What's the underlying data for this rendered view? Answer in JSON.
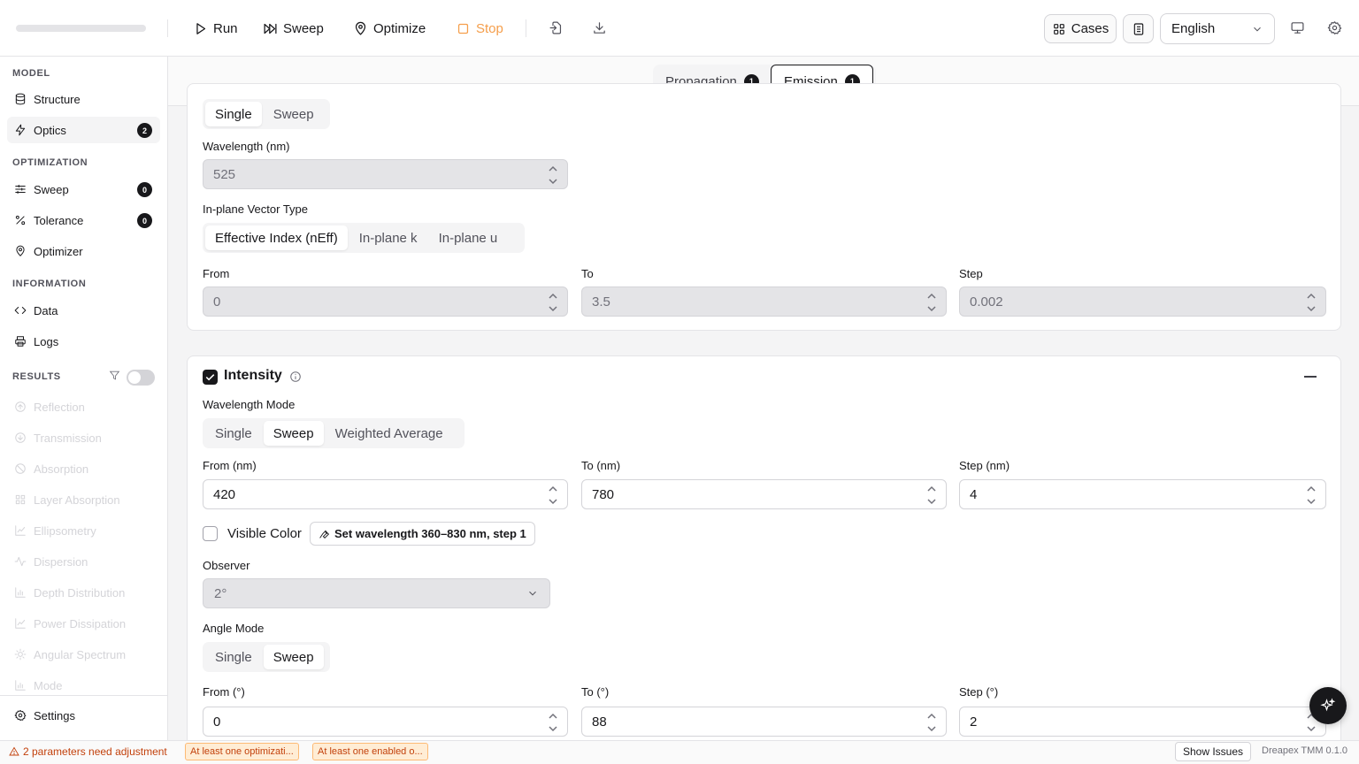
{
  "toolbar": {
    "run": "Run",
    "sweep": "Sweep",
    "optimize": "Optimize",
    "stop": "Stop",
    "cases": "Cases",
    "language": "English",
    "stop_color": "#f59e4b"
  },
  "sidebar": {
    "model_title": "MODEL",
    "structure": "Structure",
    "optics": "Optics",
    "optics_badge": "2",
    "optimization_title": "OPTIMIZATION",
    "sweep": "Sweep",
    "sweep_badge": "0",
    "tolerance": "Tolerance",
    "tolerance_badge": "0",
    "optimizer": "Optimizer",
    "information_title": "INFORMATION",
    "data": "Data",
    "logs": "Logs",
    "results_title": "RESULTS",
    "results": [
      "Reflection",
      "Transmission",
      "Absorption",
      "Layer Absorption",
      "Ellipsometry",
      "Dispersion",
      "Depth Distribution",
      "Power Dissipation",
      "Angular Spectrum",
      "Mode"
    ],
    "settings": "Settings"
  },
  "tabs": {
    "propagation": "Propagation",
    "propagation_badge": "1",
    "emission": "Emission",
    "emission_badge": "1"
  },
  "card1": {
    "mode_single": "Single",
    "mode_sweep": "Sweep",
    "wavelength_label": "Wavelength (nm)",
    "wavelength_value": "525",
    "vector_label": "In-plane Vector Type",
    "vector_options": [
      "Effective Index (nEff)",
      "In-plane k",
      "In-plane u"
    ],
    "from_label": "From",
    "from_value": "0",
    "to_label": "To",
    "to_value": "3.5",
    "step_label": "Step",
    "step_value": "0.002"
  },
  "card2": {
    "title": "Intensity",
    "wl_mode_label": "Wavelength Mode",
    "wl_modes": [
      "Single",
      "Sweep",
      "Weighted Average"
    ],
    "from_label": "From (nm)",
    "from_value": "420",
    "to_label": "To (nm)",
    "to_value": "780",
    "step_label": "Step (nm)",
    "step_value": "4",
    "visible_color": "Visible Color",
    "set_wavelength": "Set wavelength 360–830 nm, step 1",
    "observer_label": "Observer",
    "observer_value": "2°",
    "angle_mode_label": "Angle Mode",
    "angle_modes": [
      "Single",
      "Sweep"
    ],
    "afrom_label": "From (°)",
    "afrom_value": "0",
    "ato_label": "To (°)",
    "ato_value": "88",
    "astep_label": "Step (°)",
    "astep_value": "2"
  },
  "status": {
    "warning": "2 parameters need adjustment",
    "chip1": "At least one optimizati...",
    "chip2": "At least one enabled o...",
    "show_issues": "Show Issues",
    "version": "Dreapex TMM 0.1.0"
  }
}
